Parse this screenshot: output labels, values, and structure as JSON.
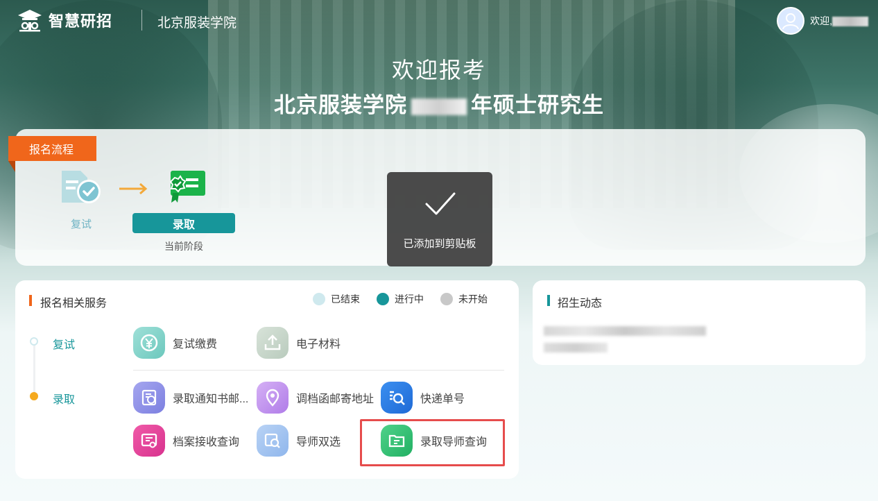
{
  "header": {
    "brand": "智慧研招",
    "school": "北京服装学院",
    "welcome_prefix": "欢迎,"
  },
  "hero": {
    "title": "欢迎报考",
    "subtitle_school": "北京服装学院",
    "subtitle_suffix": "年硕士研究生"
  },
  "flow": {
    "tag": "报名流程",
    "steps": [
      {
        "label": "复试"
      },
      {
        "label": "录取",
        "sub": "当前阶段"
      }
    ]
  },
  "toast": {
    "text": "已添加到剪贴板"
  },
  "services": {
    "title": "报名相关服务",
    "legend": [
      {
        "label": "已结束",
        "color": "#cfe9ee"
      },
      {
        "label": "进行中",
        "color": "#17969a"
      },
      {
        "label": "未开始",
        "color": "#c8c8c8"
      }
    ],
    "timeline": [
      {
        "label": "复试",
        "status": "已结束"
      },
      {
        "label": "录取",
        "status": "进行中"
      }
    ],
    "items": [
      {
        "label": "复试缴费",
        "icon": "yen-icon"
      },
      {
        "label": "电子材料",
        "icon": "upload-icon"
      },
      {
        "label": "录取通知书邮...",
        "icon": "notice-icon"
      },
      {
        "label": "调档函邮寄地址",
        "icon": "location-icon"
      },
      {
        "label": "快递单号",
        "icon": "search-list-icon"
      },
      {
        "label": "档案接收查询",
        "icon": "archive-icon"
      },
      {
        "label": "导师双选",
        "icon": "tutor-icon"
      },
      {
        "label": "录取导师查询",
        "icon": "folder-icon"
      }
    ]
  },
  "news": {
    "title": "招生动态"
  },
  "colors": {
    "accent_orange": "#f0661b",
    "accent_teal": "#17969a",
    "highlight_red": "#e64c4c"
  }
}
